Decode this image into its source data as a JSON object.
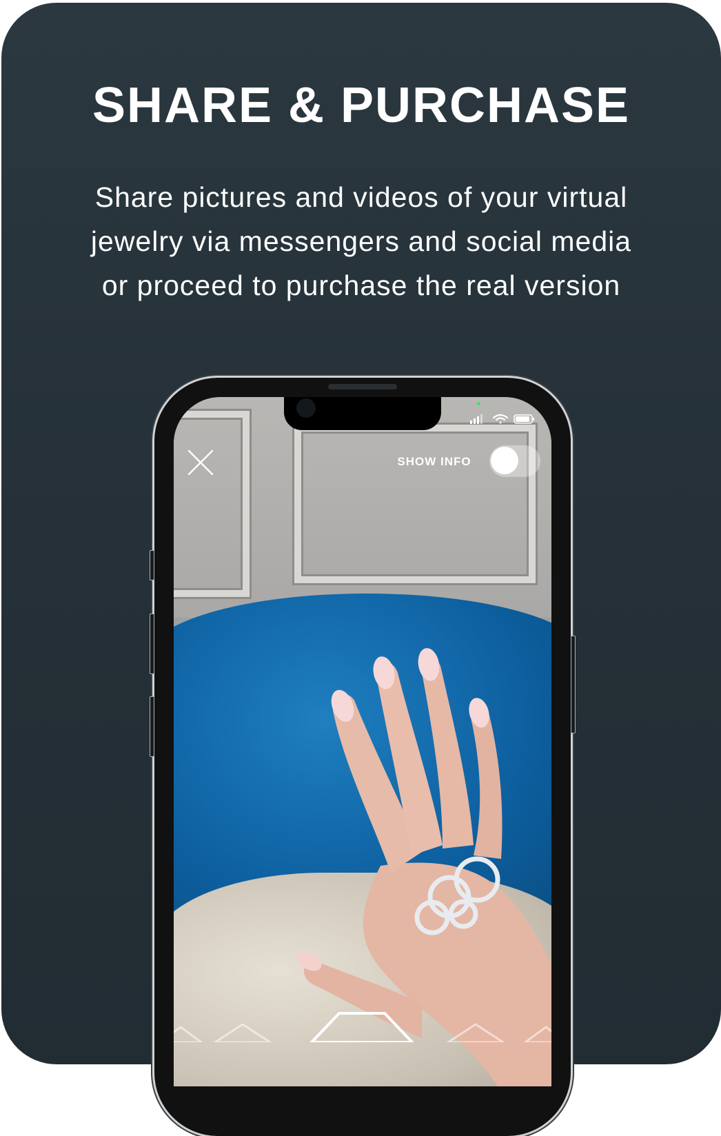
{
  "header": {
    "title": "SHARE & PURCHASE",
    "subtitle_lines": [
      "Share pictures and videos of your virtual",
      "jewelry via messengers and social media",
      "or proceed to purchase the real version"
    ]
  },
  "phone_screen": {
    "close_icon": "close-icon",
    "show_info_label": "SHOW INFO",
    "show_info_toggle_on": false,
    "status_icons": [
      "signal-icon",
      "wifi-icon",
      "battery-icon"
    ],
    "bottom_carousel_icons": [
      "hexagon-icon",
      "hexagon-icon",
      "hexagon-icon",
      "hexagon-icon",
      "hexagon-icon"
    ]
  },
  "colors": {
    "card_background": "#253038",
    "text": "#ffffff",
    "pillow_blue": "#0d5f9f"
  }
}
